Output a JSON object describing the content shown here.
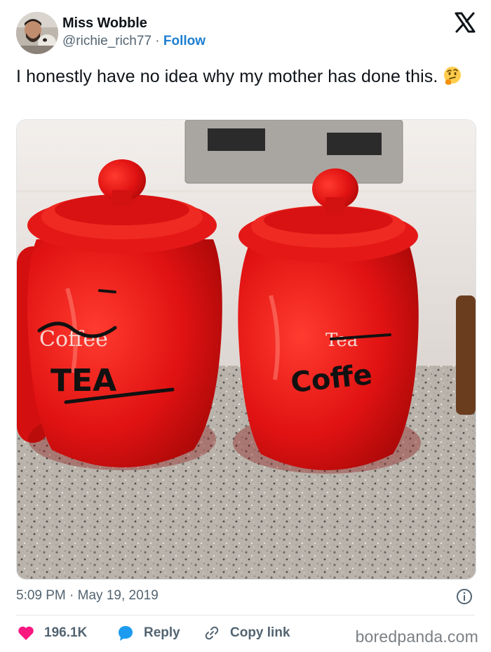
{
  "tweet": {
    "author_name": "Miss Wobble",
    "handle": "@richie_rich77",
    "separator": "·",
    "follow_label": "Follow",
    "text": "I honestly have no idea why my mother has done this.",
    "emoji": "thinking-face",
    "timestamp": "5:09 PM · May 19, 2019"
  },
  "photo": {
    "left_jar": {
      "crossed_label": "Coffee",
      "written_label": "TEA"
    },
    "right_jar": {
      "crossed_label": "Tea",
      "written_label": "Coffe"
    }
  },
  "actions": {
    "likes": "196.1K",
    "reply_label": "Reply",
    "copy_label": "Copy link"
  },
  "footer": {
    "brand": "boredpanda.com"
  },
  "colors": {
    "like": "#f91880",
    "reply": "#1d9bf0",
    "follow": "#1d7fd0",
    "jar": "#e01212"
  }
}
